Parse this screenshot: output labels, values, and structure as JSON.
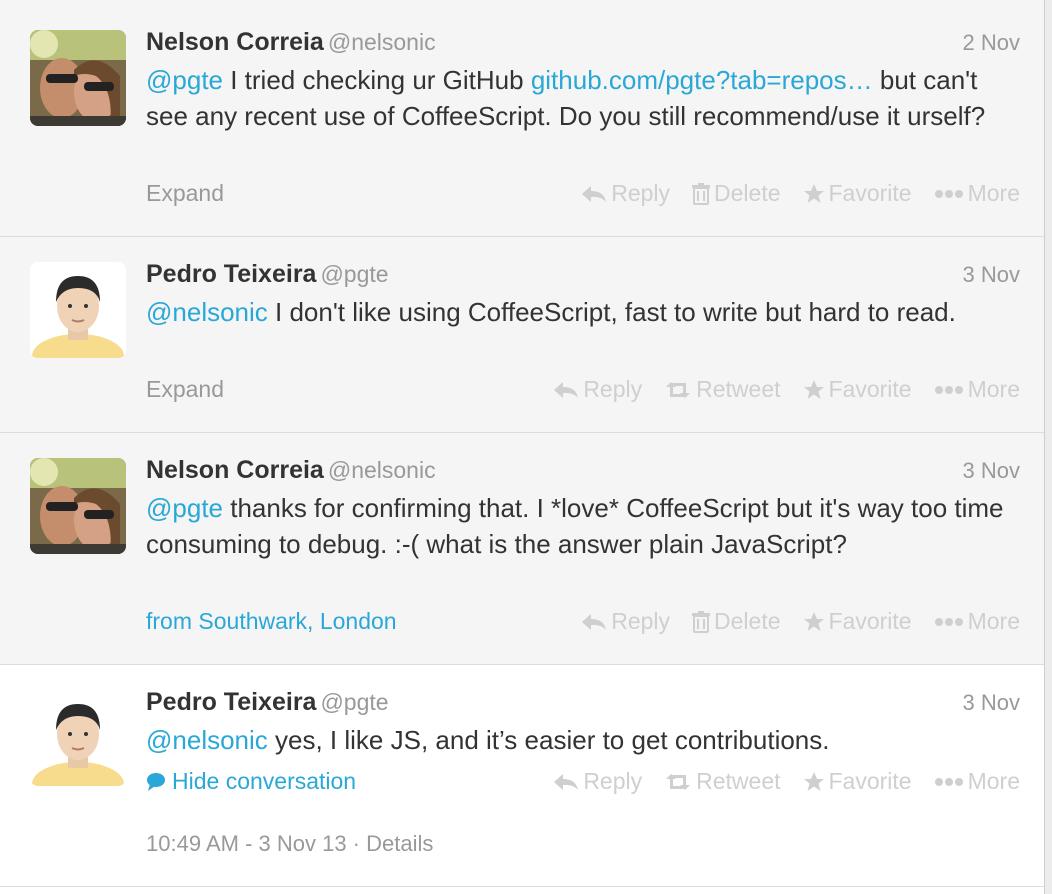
{
  "tweets": [
    {
      "name": "Nelson Correia",
      "handle": "@nelsonic",
      "time": "2 Nov",
      "parts": {
        "m1": "@pgte",
        "t1": " I tried checking ur GitHub ",
        "link": "github.com/pgte?tab=repos…",
        "t2": " but can't see any recent use of CoffeeScript. Do you still recommend/use it urself?"
      },
      "footer": "Expand",
      "actions": [
        "Reply",
        "Delete",
        "Favorite",
        "More"
      ]
    },
    {
      "name": "Pedro Teixeira",
      "handle": "@pgte",
      "time": "3 Nov",
      "parts": {
        "m1": "@nelsonic",
        "t1": " I don't like using CoffeeScript, fast to write but hard to read."
      },
      "footer": "Expand",
      "actions": [
        "Reply",
        "Retweet",
        "Favorite",
        "More"
      ]
    },
    {
      "name": "Nelson Correia",
      "handle": "@nelsonic",
      "time": "3 Nov",
      "parts": {
        "m1": "@pgte",
        "t1": " thanks for confirming that. I *love* CoffeeScript but it's way too time consuming to debug. :-( what is the answer plain JavaScript?"
      },
      "footer": "from Southwark, London",
      "actions": [
        "Reply",
        "Delete",
        "Favorite",
        "More"
      ]
    },
    {
      "name": "Pedro Teixeira",
      "handle": "@pgte",
      "time": "3 Nov",
      "parts": {
        "m1": "@nelsonic",
        "t1": " yes, I like JS, and it’s easier to get contributions."
      },
      "footer": "Hide conversation",
      "actions": [
        "Reply",
        "Retweet",
        "Favorite",
        "More"
      ],
      "meta": "10:49 AM - 3 Nov 13 · Details"
    }
  ],
  "colors": {
    "link": "#29a8d8",
    "action_disabled": "#cfcfcf",
    "muted": "#999999"
  }
}
